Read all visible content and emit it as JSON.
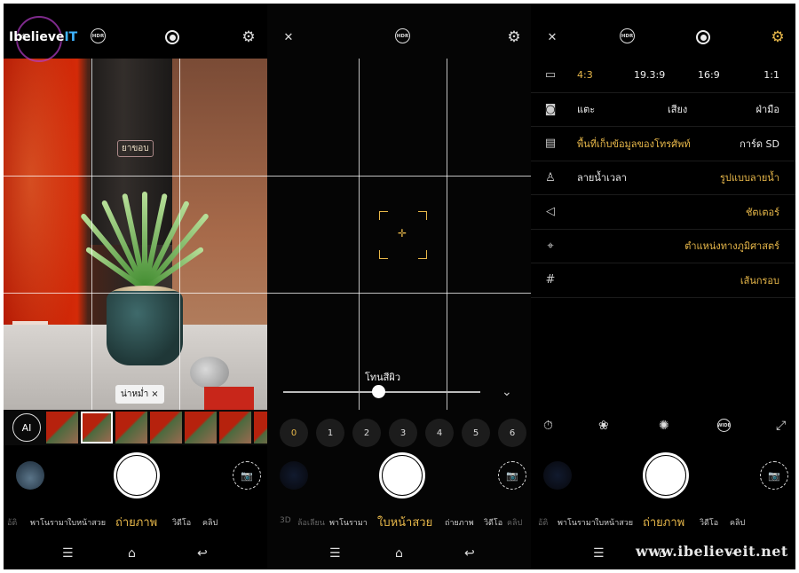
{
  "watermark": {
    "logo_text_main": "Ibelieve",
    "logo_text_accent": "IT",
    "site": "www.ibelieveit.net"
  },
  "colors": {
    "accent": "#e8b84a",
    "background": "#000000"
  },
  "panel1": {
    "top_icons": [
      "flash-off-icon",
      "hdr-icon",
      "shutter-mode-icon",
      "gear-icon"
    ],
    "hdr_label": "HDR",
    "book_label": "ยาขอบ",
    "filter_chip": "น่าหม่ำ",
    "filter_chip_close": "×",
    "ai_label": "AI",
    "modes": [
      {
        "label": "อ้ติ",
        "state": "dim"
      },
      {
        "label": "พาโนรามา",
        "state": "normal"
      },
      {
        "label": "ใบหน้าสวย",
        "state": "normal"
      },
      {
        "label": "ถ่ายภาพ",
        "state": "active"
      },
      {
        "label": "วิดีโอ",
        "state": "normal"
      },
      {
        "label": "คลิป",
        "state": "normal"
      }
    ]
  },
  "panel2": {
    "hdr_label": "HDR",
    "beauty_label": "โทนสีผิว",
    "slider_value": 0.48,
    "levels": [
      "0",
      "1",
      "2",
      "3",
      "4",
      "5",
      "6"
    ],
    "active_level": "0",
    "modes": [
      {
        "label": "3D",
        "state": "dim"
      },
      {
        "label": "ล้อเลียน",
        "state": "dim"
      },
      {
        "label": "พาโนรามา",
        "state": "normal"
      },
      {
        "label": "ใบหน้าสวย",
        "state": "active"
      },
      {
        "label": "ถ่ายภาพ",
        "state": "normal"
      },
      {
        "label": "วิดีโอ",
        "state": "normal"
      },
      {
        "label": "คลิป",
        "state": "dim"
      }
    ]
  },
  "panel3": {
    "hdr_label": "HDR",
    "settings": [
      {
        "icon": "aspect-ratio-icon",
        "options": [
          {
            "text": "4:3",
            "active": true
          },
          {
            "text": "19.3:9",
            "active": false
          },
          {
            "text": "16:9",
            "active": false
          },
          {
            "text": "1:1",
            "active": false
          }
        ]
      },
      {
        "icon": "camera-icon",
        "options": [
          {
            "text": "แตะ",
            "active": false
          },
          {
            "text": "เสียง",
            "active": false
          },
          {
            "text": "ฝ่ามือ",
            "active": false
          }
        ]
      },
      {
        "icon": "storage-icon",
        "options": [
          {
            "text": "พื้นที่เก็บข้อมูลของโทรศัพท์",
            "active": true
          },
          {
            "text": "การ์ด SD",
            "active": false
          }
        ]
      },
      {
        "icon": "watermark-icon",
        "options": [
          {
            "text": "ลายน้ำเวลา",
            "active": false
          },
          {
            "text": "รูปแบบลายน้ำ",
            "active": true
          }
        ]
      },
      {
        "icon": "shutter-sound-icon",
        "options": [
          {
            "text": "ชัตเตอร์",
            "active": true
          }
        ]
      },
      {
        "icon": "location-icon",
        "options": [
          {
            "text": "ตำแหน่งทางภูมิศาสตร์",
            "active": true
          }
        ]
      },
      {
        "icon": "grid-icon",
        "options": [
          {
            "text": "เส้นกรอบ",
            "active": true
          }
        ]
      }
    ],
    "tools": [
      "timer-icon",
      "filter-icon",
      "aperture-icon",
      "wide-icon",
      "expand-icon"
    ],
    "wide_label": "WIDE",
    "modes": [
      {
        "label": "อ้ติ",
        "state": "dim"
      },
      {
        "label": "พาโนรามา",
        "state": "normal"
      },
      {
        "label": "ใบหน้าสวย",
        "state": "normal"
      },
      {
        "label": "ถ่ายภาพ",
        "state": "active"
      },
      {
        "label": "วิดีโอ",
        "state": "normal"
      },
      {
        "label": "คลิป",
        "state": "normal"
      }
    ]
  }
}
